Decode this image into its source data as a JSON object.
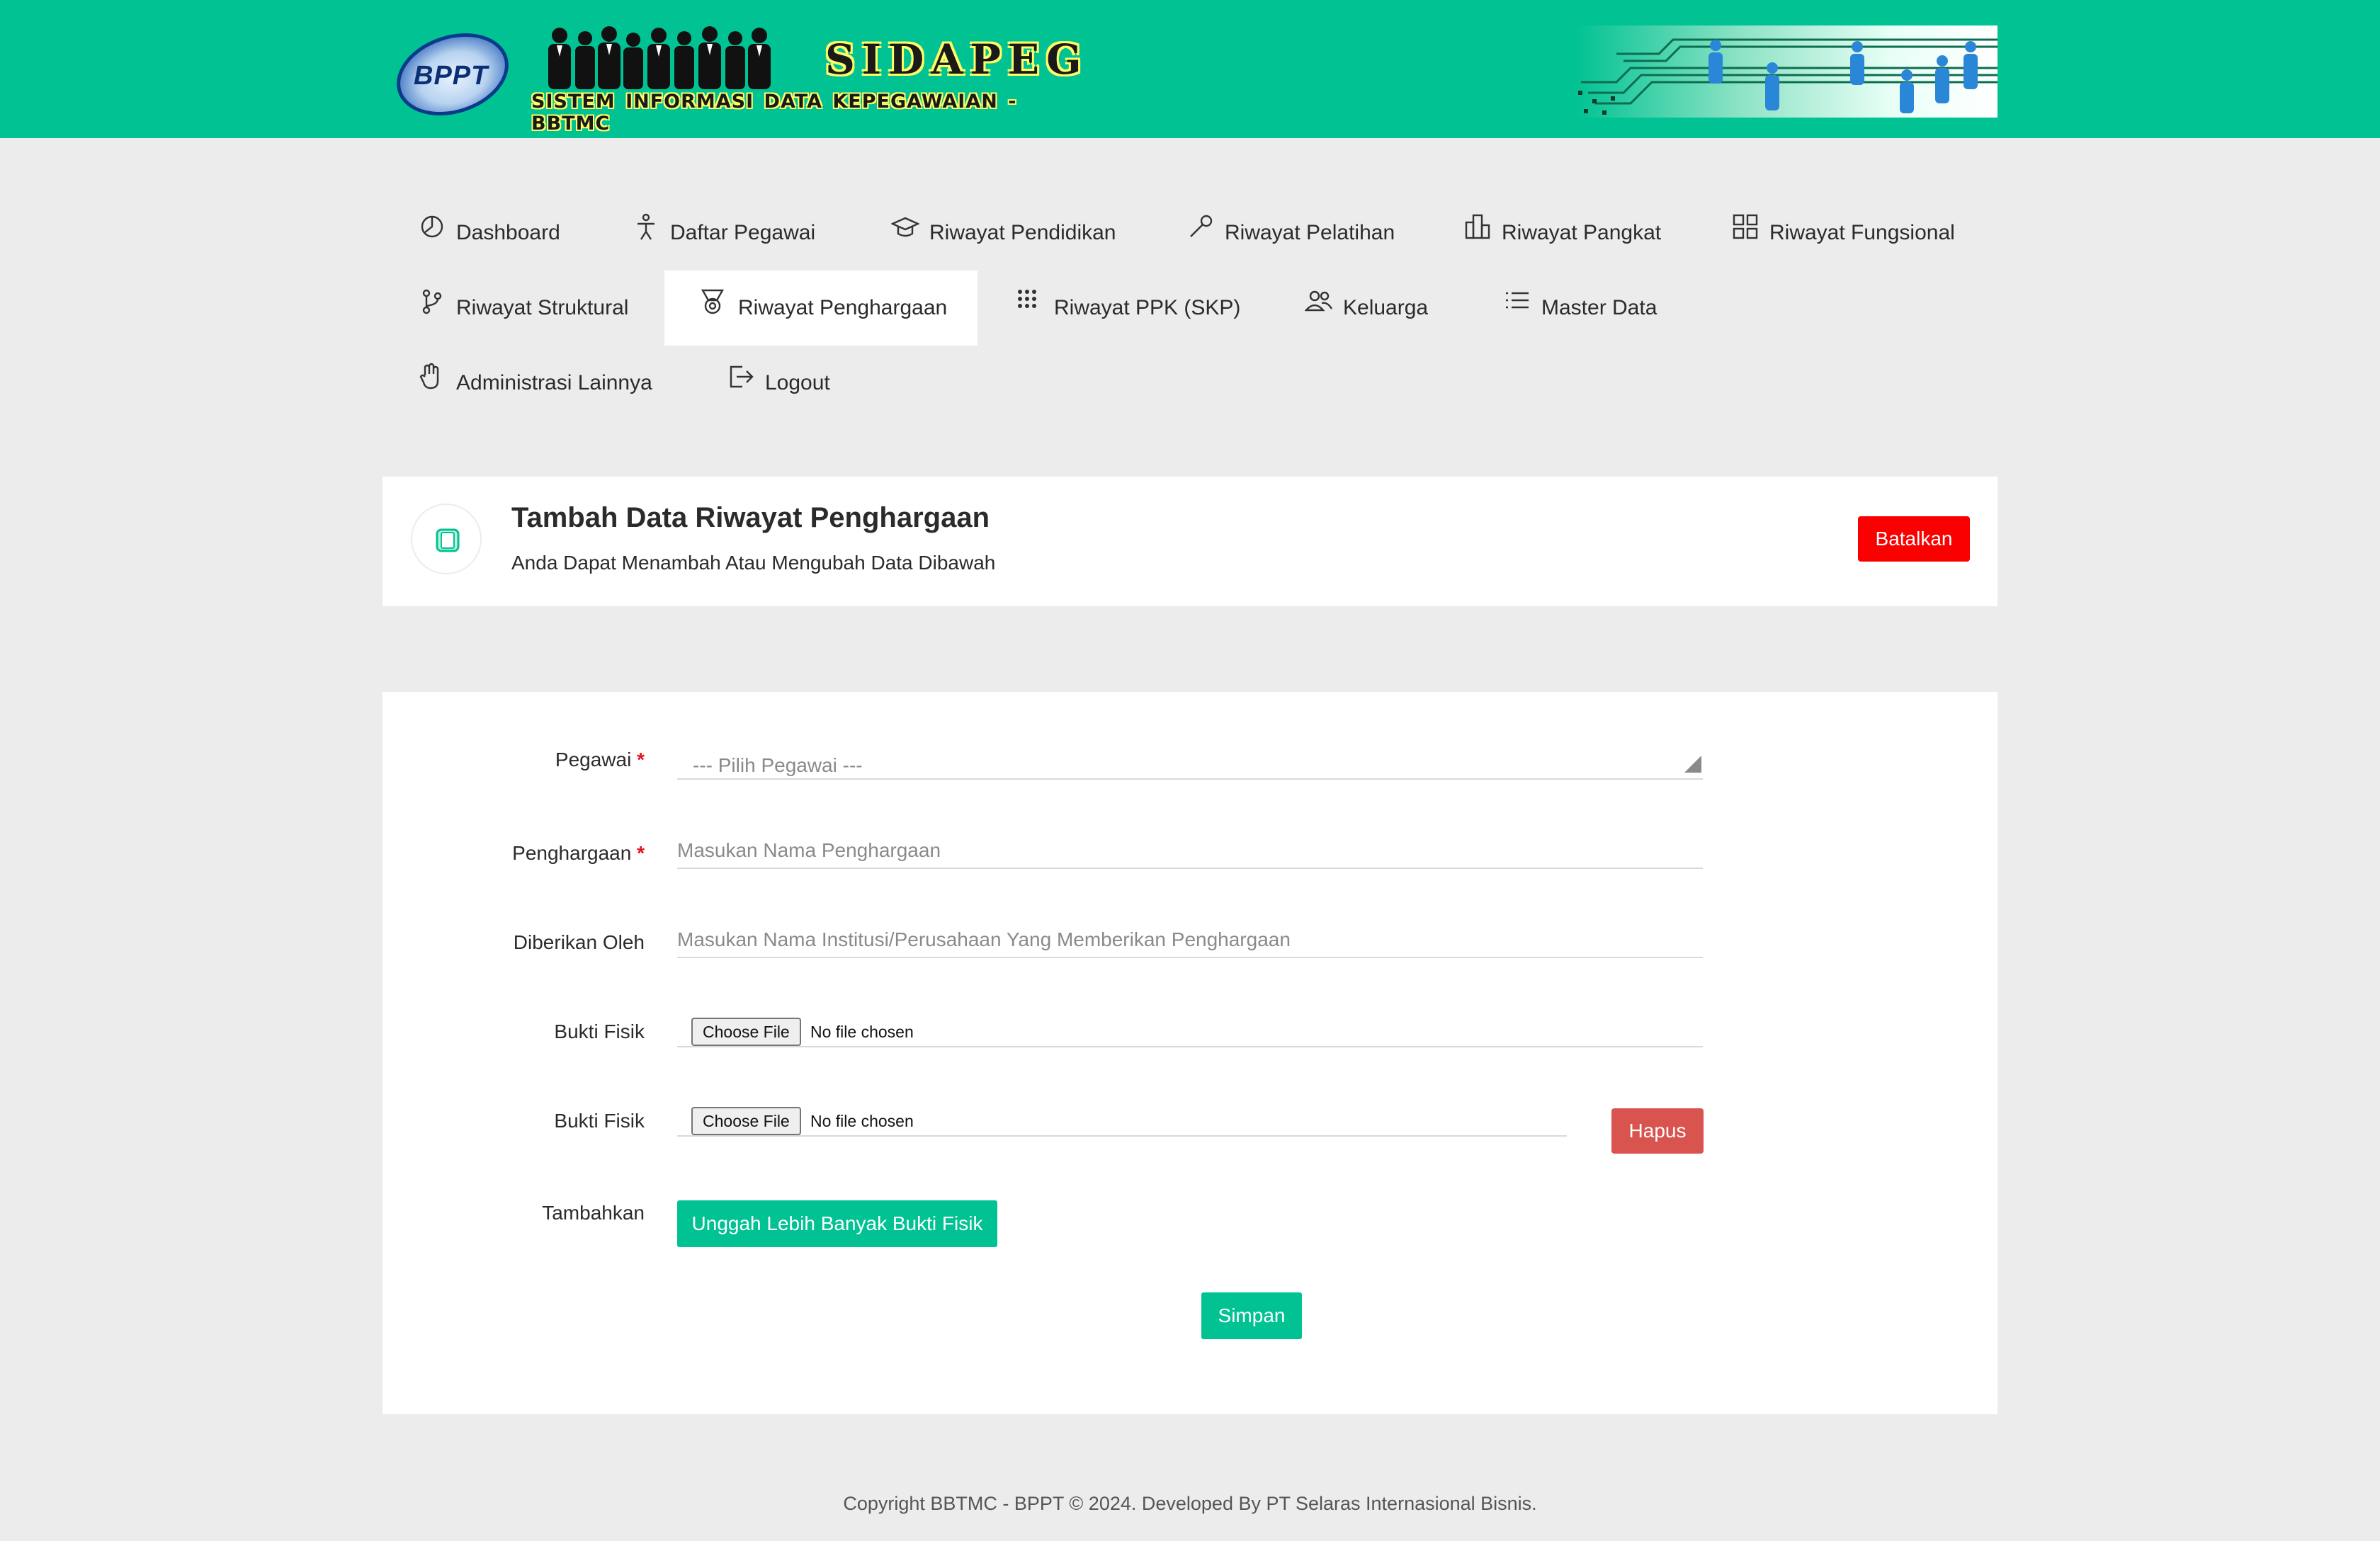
{
  "header": {
    "logo_text": "BPPT",
    "app_name": "SIDAPEG",
    "app_subtitle": "SISTEM INFORMASI DATA KEPEGAWAIAN - BBTMC"
  },
  "nav": {
    "items": [
      {
        "label": "Dashboard",
        "icon": "dashboard-icon"
      },
      {
        "label": "Daftar Pegawai",
        "icon": "person-icon"
      },
      {
        "label": "Riwayat Pendidikan",
        "icon": "graduation-cap-icon"
      },
      {
        "label": "Riwayat Pelatihan",
        "icon": "wrench-icon"
      },
      {
        "label": "Riwayat Pangkat",
        "icon": "building-icon"
      },
      {
        "label": "Riwayat Fungsional",
        "icon": "grid-icon"
      },
      {
        "label": "Riwayat Struktural",
        "icon": "branch-icon"
      },
      {
        "label": "Riwayat Penghargaan",
        "icon": "medal-icon",
        "active": true
      },
      {
        "label": "Riwayat PPK (SKP)",
        "icon": "dots-grid-icon"
      },
      {
        "label": "Keluarga",
        "icon": "users-icon"
      },
      {
        "label": "Master Data",
        "icon": "list-icon"
      },
      {
        "label": "Administrasi Lainnya",
        "icon": "hand-icon"
      },
      {
        "label": "Logout",
        "icon": "logout-icon"
      }
    ]
  },
  "page": {
    "title": "Tambah Data Riwayat Penghargaan",
    "subtitle": "Anda Dapat Menambah Atau Mengubah Data Dibawah",
    "cancel_label": "Batalkan"
  },
  "form": {
    "required_mark": "*",
    "pegawai": {
      "label": "Pegawai",
      "selected": "--- Pilih Pegawai ---"
    },
    "penghargaan": {
      "label": "Penghargaan",
      "placeholder": "Masukan Nama Penghargaan",
      "value": ""
    },
    "diberikan_oleh": {
      "label": "Diberikan Oleh",
      "placeholder": "Masukan Nama Institusi/Perusahaan Yang Memberikan Penghargaan",
      "value": ""
    },
    "bukti_fisik_1": {
      "label": "Bukti Fisik",
      "button": "Choose File",
      "status": "No file chosen"
    },
    "bukti_fisik_2": {
      "label": "Bukti Fisik",
      "button": "Choose File",
      "status": "No file chosen"
    },
    "hapus_label": "Hapus",
    "tambahkan": {
      "label": "Tambahkan",
      "button": "Unggah Lebih Banyak Bukti Fisik"
    },
    "save_label": "Simpan"
  },
  "footer": {
    "text": "Copyright BBTMC - BPPT © 2024. Developed By PT Selaras Internasional Bisnis."
  },
  "colors": {
    "brand": "#00c292",
    "danger": "#fb0000",
    "hapus": "#d9534f",
    "background": "#ececec"
  }
}
